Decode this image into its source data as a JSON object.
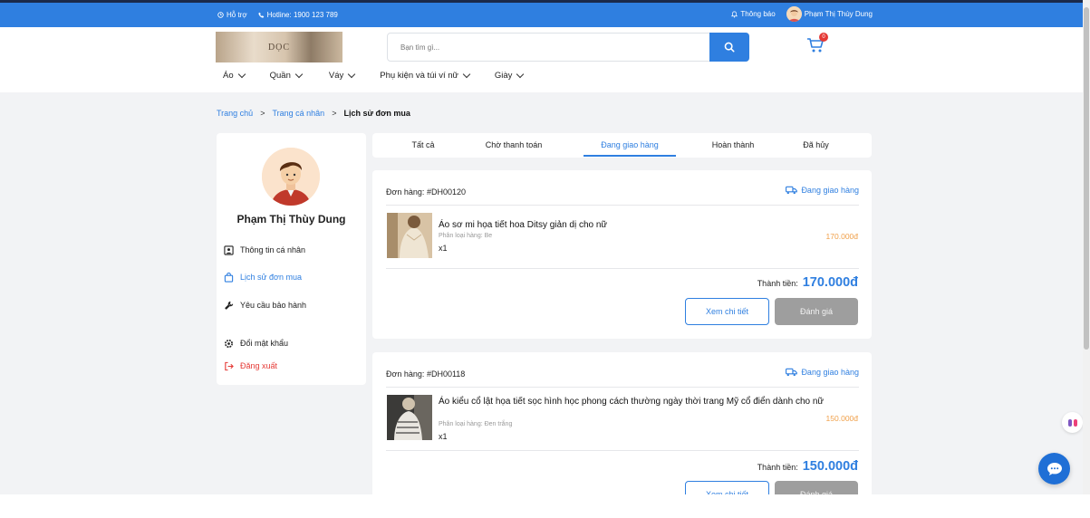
{
  "topbar": {
    "support_label": "Hỗ trợ",
    "hotline_label": "Hotline: 1900 123 789",
    "notifications_label": "Thông báo",
    "user_name": "Phạm Thị Thùy Dung"
  },
  "header": {
    "logo_text": "DỌC",
    "search_placeholder": "Bạn tìm gì...",
    "cart_count": "0"
  },
  "nav": {
    "items": [
      {
        "label": "Áo"
      },
      {
        "label": "Quần"
      },
      {
        "label": "Váy"
      },
      {
        "label": "Phụ kiện và túi ví nữ"
      },
      {
        "label": "Giày"
      }
    ]
  },
  "breadcrumb": {
    "home": "Trang chủ",
    "profile": "Trang cá nhân",
    "current": "Lịch sử đơn mua",
    "separator": ">"
  },
  "sidebar": {
    "name": "Phạm Thị Thùy Dung",
    "menu": [
      {
        "label": "Thông tin cá nhân",
        "icon": "id-card-icon"
      },
      {
        "label": "Lịch sử đơn mua",
        "icon": "shopping-bag-icon"
      },
      {
        "label": "Yêu cầu bảo hành",
        "icon": "wrench-icon"
      },
      {
        "label": "Đổi mật khẩu",
        "icon": "gear-icon"
      },
      {
        "label": "Đăng xuất",
        "icon": "logout-icon"
      }
    ]
  },
  "tabs": [
    {
      "label": "Tất cả"
    },
    {
      "label": "Chờ thanh toán"
    },
    {
      "label": "Đang giao hàng"
    },
    {
      "label": "Hoàn thành"
    },
    {
      "label": "Đã hủy"
    }
  ],
  "orders": [
    {
      "order_label": "Đơn hàng:",
      "order_id": "#DH00120",
      "status": "Đang giao hàng",
      "product_name": "Áo sơ mi họa tiết hoa Ditsy giản dị cho nữ",
      "variant": "Phân loại hàng: Be",
      "qty": "x1",
      "price": "170.000đ",
      "total_label": "Thành tiền:",
      "total_value": "170.000đ",
      "detail_button": "Xem chi tiết",
      "rate_button": "Đánh giá"
    },
    {
      "order_label": "Đơn hàng:",
      "order_id": "#DH00118",
      "status": "Đang giao hàng",
      "product_name": "Áo kiểu cổ lật họa tiết sọc hình học phong cách thường ngày thời trang Mỹ cổ điển dành cho nữ",
      "variant": "Phân loại hàng: Đen trắng",
      "qty": "x1",
      "price": "150.000đ",
      "total_label": "Thành tiền:",
      "total_value": "150.000đ",
      "detail_button": "Xem chi tiết",
      "rate_button": "Đánh giá"
    }
  ],
  "colors": {
    "primary": "#2f7fe0",
    "price": "#f0a04a",
    "logout": "#e53935",
    "disabled_button": "#9e9e9e"
  }
}
